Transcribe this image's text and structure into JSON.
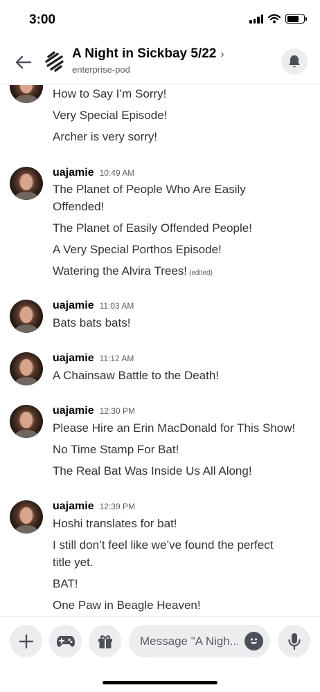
{
  "status_bar": {
    "time": "3:00"
  },
  "header": {
    "title": "A Night in Sickbay 5/22",
    "chevron": "›",
    "subtitle": "enterprise-pod",
    "icons": [
      "back-arrow-icon",
      "thread-channel-icon",
      "bell-icon"
    ]
  },
  "messages": {
    "group0": {
      "lines": [
        "How to Say I’m Sorry!",
        "Very Special Episode!",
        "Archer is very sorry!"
      ]
    },
    "group1": {
      "username": "uajamie",
      "time": "10:49 AM",
      "lines": [
        "The Planet of People Who Are Easily",
        "Offended!",
        "The Planet of Easily Offended People!",
        "A Very Special Porthos Episode!",
        "Watering the Alvira Trees!"
      ],
      "edited": "(edited)"
    },
    "group2": {
      "username": "uajamie",
      "time": "11:03 AM",
      "lines": [
        "Bats bats bats!"
      ]
    },
    "group3": {
      "username": "uajamie",
      "time": "11:12 AM",
      "lines": [
        "A Chainsaw Battle to the Death!"
      ]
    },
    "group4": {
      "username": "uajamie",
      "time": "12:30 PM",
      "lines": [
        "Please Hire an Erin MacDonald for This Show!",
        "No Time Stamp For Bat!",
        "The Real Bat Was Inside Us All Along!"
      ]
    },
    "group5": {
      "username": "uajamie",
      "time": "12:39 PM",
      "lines": [
        "Hoshi translates for bat!",
        "I still don’t feel like we’ve found the perfect",
        "title yet.",
        "BAT!",
        "One Paw in Beagle Heaven!"
      ]
    }
  },
  "composer": {
    "placeholder": "Message \"A Nigh...",
    "icons": [
      "plus-icon",
      "gamepad-icon",
      "gift-icon",
      "emoji-icon",
      "microphone-icon"
    ]
  },
  "colors": {
    "text": "#313338",
    "muted": "#5c5e66",
    "button_bg": "#ebedef"
  }
}
